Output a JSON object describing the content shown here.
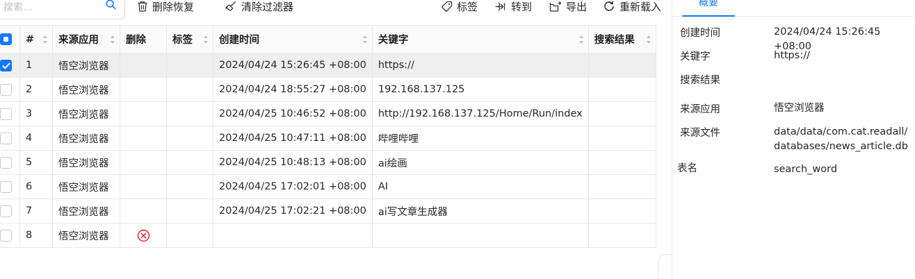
{
  "toolbar": {
    "search_placeholder": "搜索...",
    "delete_restore": "删除恢复",
    "clear_filters": "清除过滤器",
    "tag": "标签",
    "goto": "转到",
    "export": "导出",
    "reload": "重新载入"
  },
  "table": {
    "headers": [
      "#",
      "来源应用",
      "删除",
      "标签",
      "创建时间",
      "关键字",
      "搜索结果"
    ],
    "rows": [
      {
        "num": "1",
        "app": "悟空浏览器",
        "deleted": false,
        "tag": "",
        "time": "2024/04/24 15:26:45 +08:00",
        "keyword": "https://",
        "result": "",
        "checked": true
      },
      {
        "num": "2",
        "app": "悟空浏览器",
        "deleted": false,
        "tag": "",
        "time": "2024/04/24 18:55:27 +08:00",
        "keyword": "192.168.137.125",
        "result": "",
        "checked": false
      },
      {
        "num": "3",
        "app": "悟空浏览器",
        "deleted": false,
        "tag": "",
        "time": "2024/04/25 10:46:52 +08:00",
        "keyword": "http://192.168.137.125/Home/Run/index",
        "result": "",
        "checked": false
      },
      {
        "num": "4",
        "app": "悟空浏览器",
        "deleted": false,
        "tag": "",
        "time": "2024/04/25 10:47:11 +08:00",
        "keyword": "哔哩哔哩",
        "result": "",
        "checked": false
      },
      {
        "num": "5",
        "app": "悟空浏览器",
        "deleted": false,
        "tag": "",
        "time": "2024/04/25 10:48:13 +08:00",
        "keyword": "ai绘画",
        "result": "",
        "checked": false
      },
      {
        "num": "6",
        "app": "悟空浏览器",
        "deleted": false,
        "tag": "",
        "time": "2024/04/25 17:02:01 +08:00",
        "keyword": "AI",
        "result": "",
        "checked": false
      },
      {
        "num": "7",
        "app": "悟空浏览器",
        "deleted": false,
        "tag": "",
        "time": "2024/04/25 17:02:21 +08:00",
        "keyword": "ai写文章生成器",
        "result": "",
        "checked": false
      },
      {
        "num": "8",
        "app": "悟空浏览器",
        "deleted": true,
        "tag": "",
        "time": "",
        "keyword": "",
        "result": "",
        "checked": false
      }
    ]
  },
  "detail": {
    "tab": "概要",
    "created_label": "创建时间",
    "created_value": "2024/04/24 15:26:45 +08:00",
    "keyword_label": "关键字",
    "keyword_value": "https://",
    "result_label": "搜索结果",
    "result_value": "",
    "app_label": "来源应用",
    "app_value": "悟空浏览器",
    "file_label": "来源文件",
    "file_value_line1": "data/data/com.cat.readall/",
    "file_value_line2": "databases/news_article.db",
    "table_label": "表名",
    "table_value": "search_word"
  },
  "colors": {
    "accent": "#1677ff",
    "delete_icon": "#e0282e",
    "selected_row": "#efefef"
  }
}
